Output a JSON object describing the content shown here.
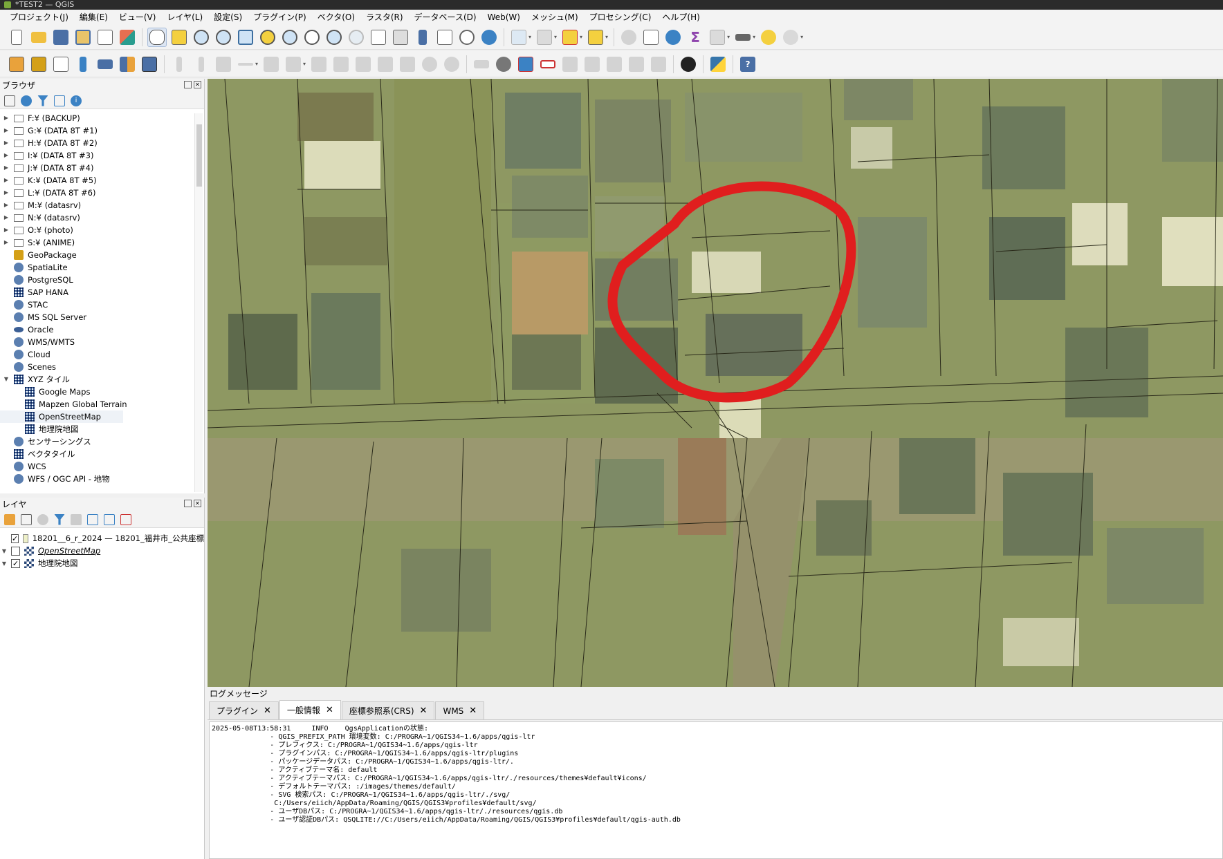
{
  "window": {
    "title": "*TEST2 — QGIS"
  },
  "menu": [
    "プロジェクト(J)",
    "編集(E)",
    "ビュー(V)",
    "レイヤ(L)",
    "設定(S)",
    "プラグイン(P)",
    "ベクタ(O)",
    "ラスタ(R)",
    "データベース(D)",
    "Web(W)",
    "メッシュ(M)",
    "プロセシング(C)",
    "ヘルプ(H)"
  ],
  "browser": {
    "title": "ブラウザ",
    "items": [
      {
        "label": "F:¥ (BACKUP)",
        "icon": "folder-icon"
      },
      {
        "label": "G:¥ (DATA 8T #1)",
        "icon": "folder-icon"
      },
      {
        "label": "H:¥ (DATA 8T #2)",
        "icon": "folder-icon"
      },
      {
        "label": "I:¥ (DATA 8T #3)",
        "icon": "folder-icon"
      },
      {
        "label": "J:¥ (DATA 8T #4)",
        "icon": "folder-icon"
      },
      {
        "label": "K:¥ (DATA 8T #5)",
        "icon": "folder-icon"
      },
      {
        "label": "L:¥ (DATA 8T #6)",
        "icon": "folder-icon"
      },
      {
        "label": "M:¥ (datasrv)",
        "icon": "folder-icon"
      },
      {
        "label": "N:¥ (datasrv)",
        "icon": "folder-icon"
      },
      {
        "label": "O:¥ (photo)",
        "icon": "folder-icon"
      },
      {
        "label": "S:¥ (ANIME)",
        "icon": "folder-icon"
      },
      {
        "label": "GeoPackage",
        "icon": "geopackage-icon"
      },
      {
        "label": "SpatiaLite",
        "icon": "spatialite-icon"
      },
      {
        "label": "PostgreSQL",
        "icon": "postgresql-icon"
      },
      {
        "label": "SAP HANA",
        "icon": "sap-hana-icon"
      },
      {
        "label": "STAC",
        "icon": "stac-icon"
      },
      {
        "label": "MS SQL Server",
        "icon": "mssql-icon"
      },
      {
        "label": "Oracle",
        "icon": "oracle-icon"
      },
      {
        "label": "WMS/WMTS",
        "icon": "wms-icon"
      },
      {
        "label": "Cloud",
        "icon": "cloud-icon"
      },
      {
        "label": "Scenes",
        "icon": "scenes-icon"
      },
      {
        "label": "XYZ タイル",
        "icon": "xyz-tiles-icon"
      },
      {
        "label": "Google Maps",
        "icon": "tile-layer-icon"
      },
      {
        "label": "Mapzen Global Terrain",
        "icon": "tile-layer-icon"
      },
      {
        "label": "OpenStreetMap",
        "icon": "tile-layer-icon"
      },
      {
        "label": "地理院地図",
        "icon": "tile-layer-icon"
      },
      {
        "label": "センサーシングス",
        "icon": "sensorthings-icon"
      },
      {
        "label": "ベクタタイル",
        "icon": "vector-tiles-icon"
      },
      {
        "label": "WCS",
        "icon": "wcs-icon"
      },
      {
        "label": "WFS / OGC API - 地物",
        "icon": "wfs-icon"
      }
    ]
  },
  "layers": {
    "title": "レイヤ",
    "items": [
      {
        "label": "18201__6_r_2024 — 18201_福井市_公共座標",
        "checked": "✓"
      },
      {
        "label": "OpenStreetMap",
        "checked": ""
      },
      {
        "label": "地理院地図",
        "checked": "✓"
      }
    ]
  },
  "log": {
    "title": "ログメッセージ",
    "tabs": [
      "プラグイン",
      "一般情報",
      "座標参照系(CRS)",
      "WMS"
    ],
    "active_tab": "一般情報",
    "lines": [
      "2025-05-08T13:58:31     INFO    QgsApplicationの状態:",
      "              - QGIS_PREFIX_PATH 環境変数: C:/PROGRA~1/QGIS34~1.6/apps/qgis-ltr",
      "              - プレフィクス: C:/PROGRA~1/QGIS34~1.6/apps/qgis-ltr",
      "              - プラグインパス: C:/PROGRA~1/QGIS34~1.6/apps/qgis-ltr/plugins",
      "              - パッケージデータパス: C:/PROGRA~1/QGIS34~1.6/apps/qgis-ltr/.",
      "              - アクティブテーマ名: default",
      "              - アクティブテーマパス: C:/PROGRA~1/QGIS34~1.6/apps/qgis-ltr/./resources/themes¥default¥icons/",
      "              - デフォルトテーマパス: :/images/themes/default/",
      "              - SVG 検索パス: C:/PROGRA~1/QGIS34~1.6/apps/qgis-ltr/./svg/",
      "               C:/Users/eiich/AppData/Roaming/QGIS/QGIS3¥profiles¥default/svg/",
      "              - ユーザDBパス: C:/PROGRA~1/QGIS34~1.6/apps/qgis-ltr/./resources/qgis.db",
      "              - ユーザ認証DBパス: QSQLITE://C:/Users/eiich/AppData/Roaming/QGIS/QGIS3¥profiles¥default/qgis-auth.db"
    ]
  },
  "colors": {
    "annotation_circle": "#e01e1e",
    "map_tint": "#8f9a5e",
    "road": "#9a9870"
  }
}
